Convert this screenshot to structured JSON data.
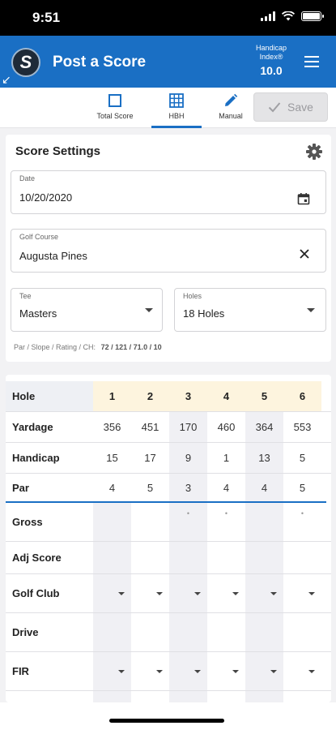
{
  "status": {
    "time": "9:51"
  },
  "header": {
    "logo_letter": "S",
    "title": "Post a Score",
    "handicap_label": "Handicap Index®",
    "handicap_value": "10.0"
  },
  "tabs": [
    {
      "label": "Total Score",
      "icon": "square-icon"
    },
    {
      "label": "HBH",
      "icon": "grid-icon"
    },
    {
      "label": "Manual",
      "icon": "pencil-icon"
    }
  ],
  "save": {
    "label": "Save"
  },
  "settings": {
    "title": "Score Settings",
    "date": {
      "label": "Date",
      "value": "10/20/2020"
    },
    "course": {
      "label": "Golf Course",
      "value": "Augusta Pines"
    },
    "tee": {
      "label": "Tee",
      "value": "Masters"
    },
    "holes": {
      "label": "Holes",
      "value": "18 Holes"
    },
    "par_info": {
      "label": "Par / Slope / Rating / CH:",
      "value": "72 / 121 / 71.0 / 10"
    }
  },
  "scorecard": {
    "hole_label": "Hole",
    "holes": [
      "1",
      "2",
      "3",
      "4",
      "5",
      "6"
    ],
    "rows": [
      {
        "label": "Yardage",
        "values": [
          "356",
          "451",
          "170",
          "460",
          "364",
          "553"
        ]
      },
      {
        "label": "Handicap",
        "values": [
          "15",
          "17",
          "9",
          "1",
          "13",
          "5"
        ]
      },
      {
        "label": "Par",
        "values": [
          "4",
          "5",
          "3",
          "4",
          "4",
          "5"
        ]
      }
    ],
    "input_rows": [
      {
        "label": "Gross",
        "dropdown": false
      },
      {
        "label": "Adj Score",
        "dropdown": false
      },
      {
        "label": "Golf Club",
        "dropdown": true
      },
      {
        "label": "Drive",
        "dropdown": false
      },
      {
        "label": "FIR",
        "dropdown": true
      }
    ]
  },
  "colors": {
    "accent": "#1a6fc4",
    "hole_header": "#fdf4de"
  }
}
